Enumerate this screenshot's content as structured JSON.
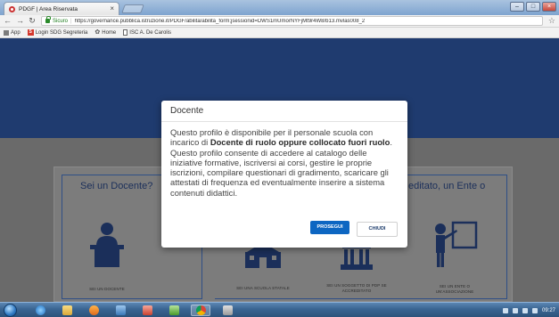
{
  "browser": {
    "tab_title": "PDGF | Area Riservata",
    "tab_close": "×",
    "secure_label": "Sicuro",
    "url": "https://governance.pubblica.istruzione.it/PDGF/abilita/abilita_form;jsessionid=DWS1mUmorNYFjMt9r4W8/b13.mvlas008_2",
    "bookmarks": [
      {
        "label": "App"
      },
      {
        "label": "Login SDG Segreteria"
      },
      {
        "label": "Home"
      },
      {
        "label": "ISC A. De Carolis"
      }
    ],
    "sdg_icon_text": "S"
  },
  "page": {
    "left_column_title": "Sei un Docente?",
    "right_column_title": "editato, un Ente o",
    "cards": [
      {
        "label": "SEI UN DOCENTE"
      },
      {
        "label": "SEI UNA SCUOLA STATALE"
      },
      {
        "label": "SEI UN SOGGETTO DI PDP SE ACCREDITATO"
      },
      {
        "label": "SEI UN ENTE O UN'ASSOCIAZIONE"
      }
    ]
  },
  "modal": {
    "title": "Docente",
    "body_intro": "Questo profilo è disponibile per il personale scuola con incarico di ",
    "body_bold": "Docente di ruolo oppure collocato fuori ruolo",
    "body_rest": ". Questo profilo consente di accedere al catalogo delle iniziative formative, iscriversi ai corsi, gestire le proprie iscrizioni, compilare questionari di gradimento, scaricare gli attestati di frequenza ed eventualmente inserire a sistema contenuti didattici.",
    "proceed_label": "PROSEGUI",
    "close_label": "CHIUDI"
  },
  "taskbar": {
    "clock": "09:27"
  },
  "colors": {
    "header": "#1f3b6f",
    "primary_button": "#0d66c2",
    "accent_text": "#1b2f5a"
  }
}
